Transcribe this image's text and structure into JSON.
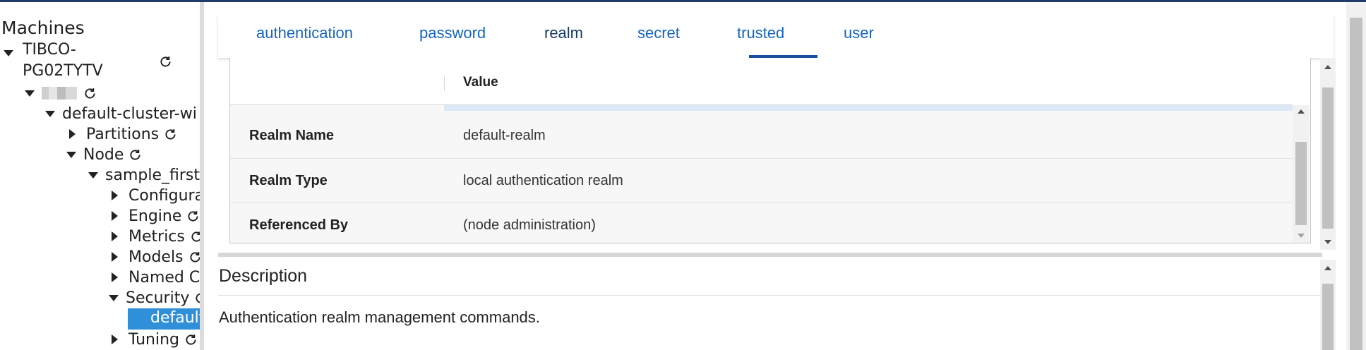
{
  "sidebar": {
    "title": "Machines",
    "tree": [
      {
        "label": "TIBCO-",
        "label2": "PG02TYTV",
        "expanded": true
      },
      {
        "label": "",
        "expanded": true,
        "blurred": true
      },
      {
        "label": "default-cluster-wi",
        "expanded": true
      },
      {
        "label": "Partitions",
        "expanded": false
      },
      {
        "label": "Node",
        "expanded": true
      },
      {
        "label": "sample_first",
        "expanded": true
      },
      {
        "label": "Configura",
        "expanded": false
      },
      {
        "label": "Engine",
        "expanded": false
      },
      {
        "label": "Metrics",
        "expanded": false
      },
      {
        "label": "Models",
        "expanded": false
      },
      {
        "label": "Named C",
        "expanded": false
      },
      {
        "label": "Security",
        "expanded": true
      },
      {
        "label": "default",
        "selected": true
      },
      {
        "label": "Tuning",
        "expanded": false
      }
    ]
  },
  "tabs": [
    "authentication",
    "password",
    "realm",
    "secret",
    "trusted",
    "user"
  ],
  "active_tab": "realm",
  "table": {
    "value_header": "Value",
    "rows": [
      {
        "key": "Realm Name",
        "value": "default-realm"
      },
      {
        "key": "Realm Type",
        "value": "local authentication realm"
      },
      {
        "key": "Referenced By",
        "value": "(node administration)"
      }
    ]
  },
  "description": {
    "title": "Description",
    "text": "Authentication realm management commands."
  },
  "icons": {
    "refresh": "refresh-icon",
    "expand": "caret-down-icon",
    "collapse": "caret-right-icon"
  },
  "colors": {
    "accent": "#1565c0",
    "tab_underline": "#1b4f9c",
    "selection": "#2f8fd8"
  }
}
